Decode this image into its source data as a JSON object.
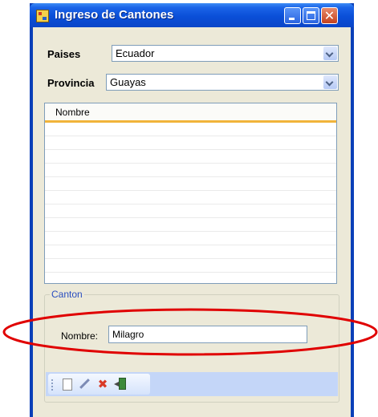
{
  "window": {
    "title": "Ingreso de Cantones"
  },
  "filters": {
    "paises_label": "Paises",
    "paises_value": "Ecuador",
    "provincia_label": "Provincia",
    "provincia_value": "Guayas"
  },
  "grid": {
    "columns": [
      "Nombre"
    ],
    "rows": []
  },
  "canton_group": {
    "title": "Canton",
    "nombre_label": "Nombre:",
    "nombre_value": "Milagro"
  },
  "toolbar": {
    "buttons": [
      "new-document-icon",
      "edit-pencil-icon",
      "delete-x-icon",
      "exit-door-icon"
    ]
  },
  "annotation": {
    "highlight_color": "#e00000"
  },
  "colors": {
    "titlebar": "#0a4fd8",
    "client_bg": "#ece9d8",
    "grid_header_accent": "#f1b43a",
    "group_title": "#2a4ec0",
    "toolbar_bg": "#c4d6f8"
  }
}
